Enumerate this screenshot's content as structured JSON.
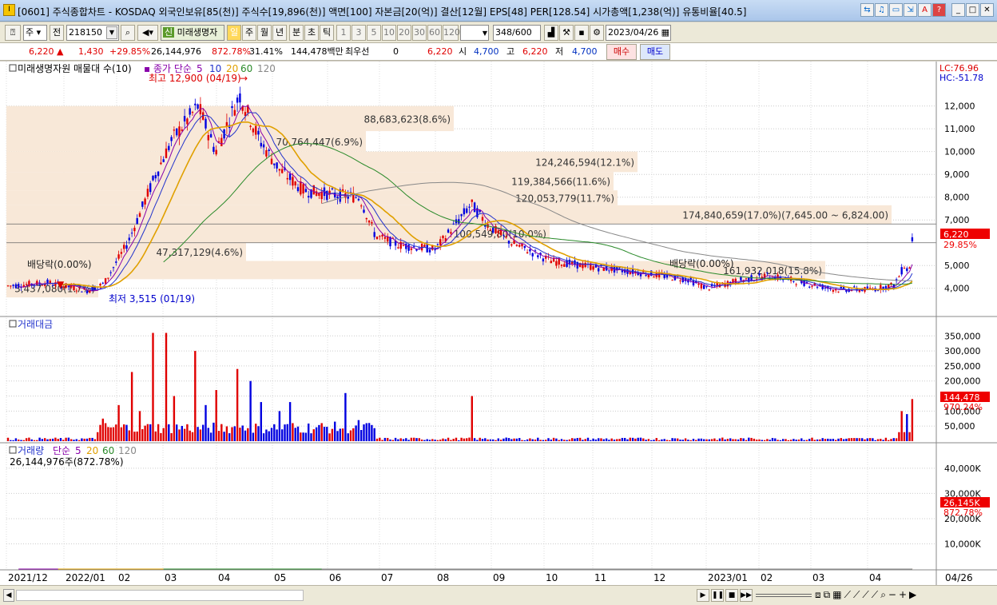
{
  "window": {
    "app_icon": "I",
    "title": "[0601] 주식종합차트 - KOSDAQ 외국인보유[85(천)] 주식수[19,896(천)] 액면[100] 자본금[20(억)] 결산[12월] EPS[48] PER[128.54] 시가총액[1,238(억)] 유통비율[40.5]",
    "buttons": [
      "link-icon",
      "notes-icon",
      "window-icon",
      "pin-icon",
      "font-icon",
      "help-icon",
      "minimize-icon",
      "maximize-icon",
      "close-icon"
    ],
    "button_glyphs": [
      "⇆",
      "♫",
      "▭",
      "⇲",
      "A",
      "?",
      "_",
      "□",
      "✕"
    ]
  },
  "toolbar": {
    "market": "주",
    "prefix": "전",
    "code": "218150",
    "name": "미래생명자",
    "periods": [
      "일",
      "주",
      "월",
      "년",
      "분",
      "초",
      "틱"
    ],
    "intervals": [
      "1",
      "3",
      "5",
      "10",
      "20",
      "30",
      "60",
      "120"
    ],
    "count": "348",
    "count_total": "/600",
    "date": "2023/04/26"
  },
  "quote": {
    "price": "6,220",
    "change": "1,430",
    "change_pct": "+29.85%",
    "volume": "26,144,976",
    "vol_ratio": "872.78%",
    "turnover": "31.41%",
    "amount": "144,478백만",
    "priority_label": "최우선",
    "priority_val": "0",
    "price2": "6,220",
    "open_label": "시",
    "open": "4,700",
    "high_label": "고",
    "high": "6,220",
    "low_label": "저",
    "low": "4,700",
    "buy": "매수",
    "sell": "매도"
  },
  "colors": {
    "up": "#e00000",
    "down": "#0000e0",
    "ma5": "#8800aa",
    "ma10": "#2233cc",
    "ma20": "#e0a000",
    "ma60": "#2a8a2a",
    "ma120": "#888888"
  },
  "price_pane": {
    "legend_title": "미래생명자원 매물대 수(10)",
    "legend_ma_label": "종가 단순",
    "legend_periods": [
      "5",
      "10",
      "20",
      "60",
      "120"
    ],
    "high_annot": "최고 12,900 (04/19)",
    "low_annot": "최저 3,515 (01/19)",
    "dividend_labels": [
      "배당락(0.00%)",
      "배당락(0.00%)"
    ],
    "lc": "LC:76.96",
    "hc": "HC:-51.78",
    "last_price": "6,220",
    "last_pct": "29.85%",
    "y_ticks": [
      "12,000",
      "11,000",
      "10,000",
      "9,000",
      "8,000",
      "7,000",
      "5,000",
      "4,000"
    ],
    "volume_profile": [
      "88,683,623(8.6%)",
      "70,764,447(6.9%)",
      "124,246,594(12.1%)",
      "119,384,566(11.6%)",
      "120,053,779(11.7%)",
      "174,840,659(17.0%)(7,645.00 ~ 6,824.00)",
      "100,549,80(10.0%)",
      "47,317,129(4.6%)",
      "161,932,018(15.8%)",
      "3,437,080(1.7%)"
    ]
  },
  "amount_pane": {
    "legend": "거래대금",
    "last_value": "144,478",
    "last_pct": "970.24%",
    "y_ticks": [
      "350,000",
      "300,000",
      "250,000",
      "200,000",
      "150,000",
      "100,000",
      "50,000"
    ]
  },
  "volume_pane": {
    "legend_title": "거래량",
    "legend_ma_label": "단순",
    "legend_periods": [
      "5",
      "20",
      "60",
      "120"
    ],
    "summary": "26,144,976주(872.78%)",
    "last_value": "26,145K",
    "last_pct": "872.78%",
    "y_ticks": [
      "40,000K",
      "30,000K",
      "20,000K",
      "10,000K"
    ]
  },
  "x_axis": {
    "labels": [
      "2021/12",
      "2022/01",
      "02",
      "03",
      "04",
      "05",
      "06",
      "07",
      "08",
      "09",
      "10",
      "11",
      "12",
      "2023/01",
      "02",
      "03",
      "04"
    ],
    "right_label": "04/26"
  },
  "chart_data": {
    "type": "candlestick",
    "title": "미래생명자원",
    "x": [
      "2021/12",
      "2022/01",
      "02",
      "03",
      "04",
      "05",
      "06",
      "07",
      "08",
      "09",
      "10",
      "11",
      "12",
      "2023/01",
      "02",
      "03",
      "04",
      "04/26"
    ],
    "close_approx": [
      4200,
      4000,
      5200,
      10000,
      11500,
      8200,
      8000,
      5500,
      5400,
      7600,
      5600,
      4800,
      4400,
      4200,
      4400,
      4000,
      4100,
      6220
    ],
    "price_ylim": [
      3500,
      13000
    ],
    "amount_ylim": [
      0,
      380000
    ],
    "volume_ylim_k": [
      0,
      46000
    ],
    "grid": true
  }
}
